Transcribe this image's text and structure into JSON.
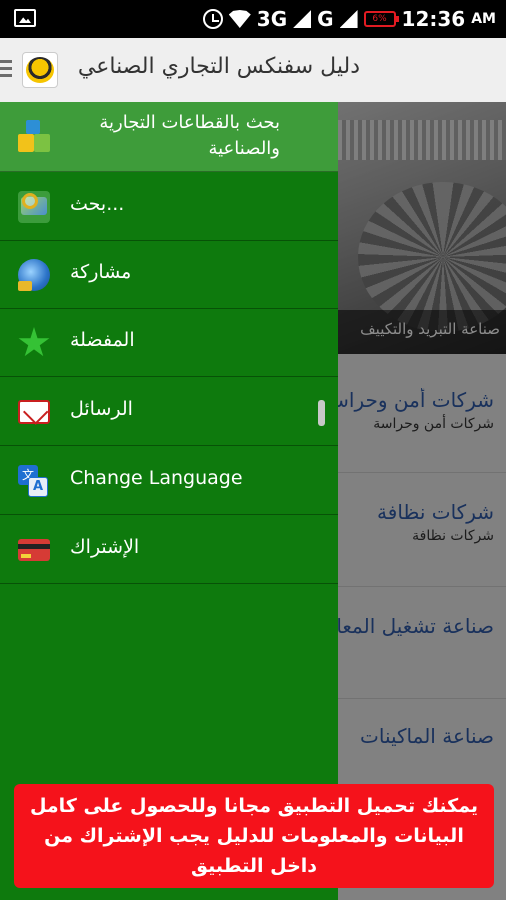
{
  "status_bar": {
    "network_3g": "3G",
    "network_g": "G",
    "battery": "6%",
    "time": "12:36",
    "ampm": "AM"
  },
  "app_bar": {
    "title": "دليل سفنكس التجاري الصناعي"
  },
  "background": {
    "banner_caption": "صناعة التبريد والتكييف",
    "items": [
      {
        "title": "شركات أمن وحراسة",
        "subtitle": "شركات أمن وحراسة"
      },
      {
        "title": "شركات نظافة",
        "subtitle": "شركات نظافة"
      },
      {
        "title": "صناعة تشغيل المعادن",
        "subtitle": ""
      },
      {
        "title": "صناعة الماكينات",
        "subtitle": ""
      }
    ]
  },
  "drawer": {
    "header": "بحث بالقطاعات التجارية والصناعية",
    "items": [
      {
        "label": "بحث...",
        "icon": "map-search-icon"
      },
      {
        "label": "مشاركة",
        "icon": "globe-share-icon"
      },
      {
        "label": "المفضلة",
        "icon": "star-icon"
      },
      {
        "label": "الرسائل",
        "icon": "mail-icon"
      },
      {
        "label": "Change Language",
        "icon": "translate-icon"
      },
      {
        "label": "الإشتراك",
        "icon": "subscription-card-icon"
      }
    ]
  },
  "notice": {
    "text": "يمكنك تحميل التطبيق مجانا وللحصول على كامل البيانات والمعلومات للدليل يجب الإشتراك من داخل التطبيق"
  }
}
